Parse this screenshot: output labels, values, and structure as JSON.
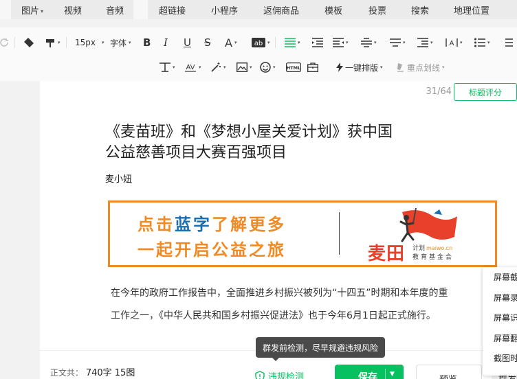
{
  "tabs": [
    {
      "label": "图片",
      "dropdown": true
    },
    {
      "label": "视频",
      "dropdown": false
    },
    {
      "label": "音频",
      "dropdown": false
    },
    {
      "label": "超链接",
      "dropdown": false
    },
    {
      "label": "小程序",
      "dropdown": false
    },
    {
      "label": "返佣商品",
      "dropdown": false
    },
    {
      "label": "模板",
      "dropdown": false
    },
    {
      "label": "投票",
      "dropdown": false
    },
    {
      "label": "搜索",
      "dropdown": false
    },
    {
      "label": "地理位置",
      "dropdown": false
    }
  ],
  "toolbar": {
    "font_size": "15px",
    "font_family": "字体",
    "one_click_layout": "一键排版",
    "highlight_line": "重点划线"
  },
  "editor": {
    "counter": "31/64",
    "score_button": "标题评分",
    "title_line1": "《麦苗班》和《梦想小屋关爱计划》获中国",
    "title_line2": "公益慈善项目大赛百强项目",
    "author": "麦小妞",
    "banner": {
      "line1_a": "点击",
      "line1_b": "蓝字",
      "line1_c": "了解更多",
      "line2": "一起开启公益之旅",
      "logo_main": "麦田",
      "logo_plan": "计划",
      "logo_site": "maiwo.cn",
      "logo_fund": "教育基金会"
    },
    "paragraph_line1": "在今年的政府工作报告中，全面推进乡村振兴被列为“十四五”时期和本年度的重",
    "paragraph_line2": "工作之一，《中华人民共和国乡村振兴促进法》也于今年6月1日起正式施行。"
  },
  "bottom": {
    "wordcount_label": "正文共：",
    "wordcount_value": "740字 15图",
    "check_link": "违规检测",
    "save": "保存",
    "preview": "预览",
    "publish": "群发"
  },
  "tooltip": "群发前检测，尽早规避违规风险",
  "context_menu": [
    "屏幕截图",
    "屏幕录制",
    "屏幕识图",
    "屏幕翻译",
    "截图时隐藏"
  ],
  "colors": {
    "accent": "#07c160",
    "banner_orange": "#f08a24",
    "banner_blue": "#1a6fb0",
    "logo_red": "#e8412b"
  }
}
